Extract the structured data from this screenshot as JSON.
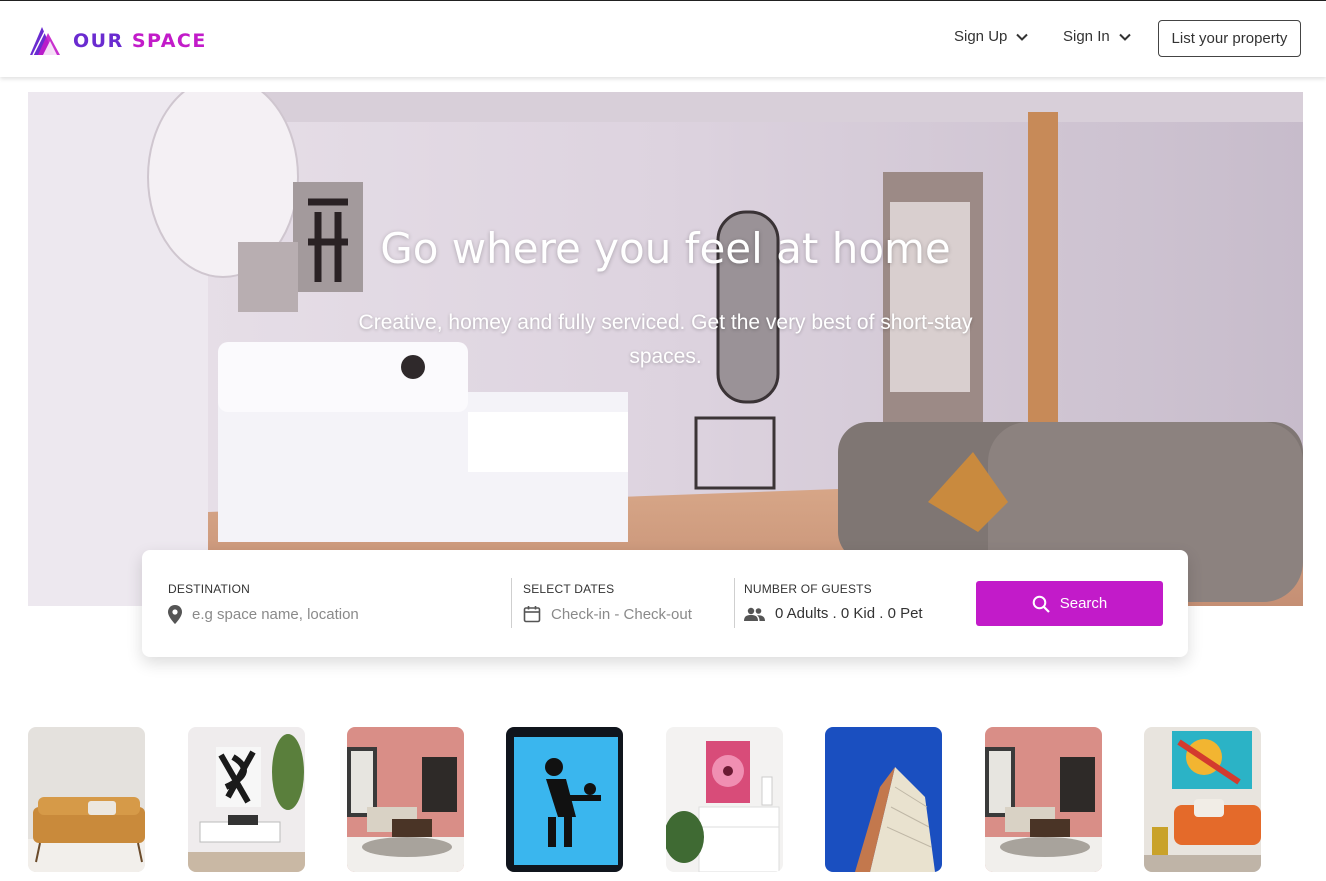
{
  "brand": {
    "name_part1": "OUR",
    "name_part2": "SPACE",
    "color_primary": "#6a2bd0",
    "color_accent": "#c21bc9"
  },
  "nav": {
    "signup_label": "Sign Up",
    "signin_label": "Sign In",
    "list_property_label": "List your property"
  },
  "hero": {
    "title": "Go where you feel at home",
    "subtitle": "Creative, homey and fully serviced. Get the very best of short-stay spaces."
  },
  "search": {
    "destination_label": "DESTINATION",
    "destination_placeholder": "e.g space name, location",
    "dates_label": "SELECT DATES",
    "dates_placeholder": "Check-in - Check-out",
    "guests_label": "NUMBER OF GUESTS",
    "guests_value": "0 Adults . 0 Kid . 0 Pet",
    "button_label": "Search",
    "icons": [
      "location-pin-icon",
      "calendar-icon",
      "people-icon",
      "search-icon"
    ]
  },
  "gallery": {
    "items": [
      {
        "name": "living-room-yellow-sofa"
      },
      {
        "name": "white-bench-black-art"
      },
      {
        "name": "pink-wall-living-room"
      },
      {
        "name": "baby-changing-sign"
      },
      {
        "name": "pink-flower-painting"
      },
      {
        "name": "tall-building-blue-sky"
      },
      {
        "name": "pink-wall-living-room-2"
      },
      {
        "name": "orange-sofa-colorful-art"
      }
    ]
  }
}
